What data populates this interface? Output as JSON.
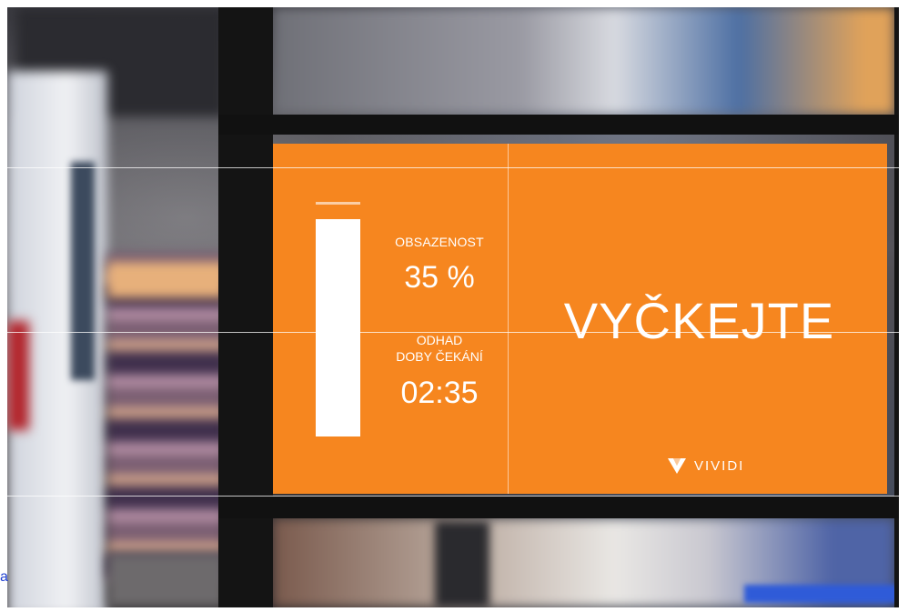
{
  "sign": {
    "occupancy_label": "OBSAZENOST",
    "occupancy_value": "35 %",
    "occupancy_fraction": 0.35,
    "wait_label_line1": "ODHAD",
    "wait_label_line2": "DOBY ČEKÁNÍ",
    "wait_value": "02:35",
    "status": "VYČKEJTE",
    "brand": "VIVIDI"
  },
  "edge_text": "a",
  "colors": {
    "screen": "#f6861f",
    "text": "#ffffff"
  },
  "icons": {
    "brand_logo": "vividi-logo-icon"
  }
}
